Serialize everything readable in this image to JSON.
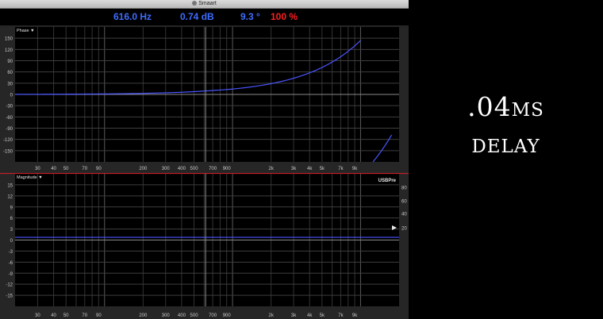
{
  "window": {
    "title": "Smaart"
  },
  "readout": {
    "frequency": "616.0 Hz",
    "magnitude": "0.74 dB",
    "phase": "9.3 °",
    "coherence": "100 %",
    "colors": {
      "frequency": "#3d6cff",
      "magnitude": "#3d6cff",
      "phase": "#3d6cff",
      "coherence": "#ff1f1f"
    }
  },
  "phase_panel": {
    "label": "Phase ▼",
    "y_ticks": [
      "150",
      "120",
      "90",
      "60",
      "30",
      "0",
      "-30",
      "-60",
      "-90",
      "-120",
      "-150"
    ]
  },
  "magnitude_panel": {
    "label": "Magnitude ▼",
    "device": "USBPre",
    "y_ticks": [
      "15",
      "12",
      "9",
      "6",
      "3",
      "0",
      "-3",
      "-6",
      "-9",
      "-12",
      "-15"
    ],
    "right_ticks": [
      "80",
      "60",
      "40",
      "20"
    ]
  },
  "x_ticks": [
    "30",
    "40",
    "50",
    "70",
    "90",
    "200",
    "300",
    "400",
    "500",
    "700",
    "900",
    "2k",
    "3k",
    "4k",
    "5k",
    "7k",
    "9k"
  ],
  "side_caption": {
    "line1": ".04ms",
    "line2": "delay"
  },
  "chart_data": [
    {
      "type": "line",
      "title": "Phase",
      "ylim": [
        -180,
        180
      ],
      "xlim_hz": [
        20,
        20000
      ],
      "x_scale": "log",
      "grid": true,
      "cursor_hz": 616.0,
      "series": [
        {
          "x": [
            20,
            50,
            100,
            200,
            400,
            616,
            1000,
            2000,
            3000,
            4000,
            5000,
            6000,
            7000,
            8000,
            9000,
            10000
          ],
          "y": [
            0.3,
            0.7,
            1.4,
            2.9,
            5.8,
            9.3,
            14.4,
            28.8,
            43.2,
            57.6,
            72,
            86.4,
            100.8,
            115.2,
            129.6,
            144
          ]
        },
        {
          "x": [
            12500,
            13500,
            14500,
            15500,
            16500,
            17500
          ],
          "y": [
            -180,
            -165.6,
            -151.2,
            -136.8,
            -122.4,
            -108
          ]
        }
      ]
    },
    {
      "type": "line",
      "title": "Magnitude",
      "ylim": [
        -18,
        18
      ],
      "xlim_hz": [
        20,
        20000
      ],
      "x_scale": "log",
      "grid": true,
      "cursor_hz": 616.0,
      "series": [
        {
          "x": [
            20,
            20000
          ],
          "y": [
            0.74,
            0.74
          ]
        }
      ]
    }
  ]
}
